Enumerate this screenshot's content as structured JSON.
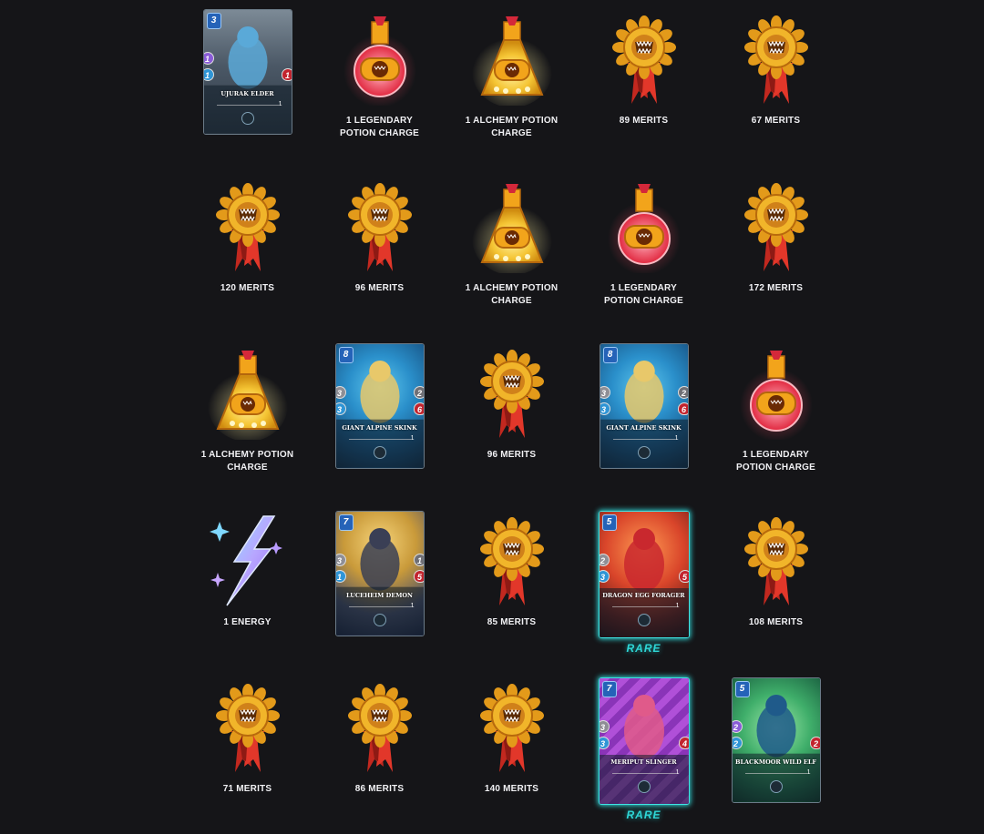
{
  "rewards": [
    {
      "kind": "card",
      "name": "UJURAK ELDER",
      "mana": "3",
      "attack": "1",
      "attack_type": "magic",
      "speed": "1",
      "health": "1",
      "level": "1",
      "theme": "ujurak"
    },
    {
      "kind": "legendary_potion",
      "label": "1 LEGENDARY POTION CHARGE"
    },
    {
      "kind": "alchemy_potion",
      "label": "1 ALCHEMY POTION CHARGE"
    },
    {
      "kind": "merits",
      "label": "89 MERITS"
    },
    {
      "kind": "merits",
      "label": "67 MERITS"
    },
    {
      "kind": "merits",
      "label": "120 MERITS"
    },
    {
      "kind": "merits",
      "label": "96 MERITS"
    },
    {
      "kind": "alchemy_potion",
      "label": "1 ALCHEMY POTION CHARGE"
    },
    {
      "kind": "legendary_potion",
      "label": "1 LEGENDARY POTION CHARGE"
    },
    {
      "kind": "merits",
      "label": "172 MERITS"
    },
    {
      "kind": "alchemy_potion",
      "label": "1 ALCHEMY POTION CHARGE"
    },
    {
      "kind": "card",
      "name": "GIANT ALPINE SKINK",
      "mana": "8",
      "attack": "3",
      "attack_type": "melee",
      "speed": "3",
      "armor": "2",
      "health": "6",
      "level": "1",
      "theme": "skink"
    },
    {
      "kind": "merits",
      "label": "96 MERITS"
    },
    {
      "kind": "card",
      "name": "GIANT ALPINE SKINK",
      "mana": "8",
      "attack": "3",
      "attack_type": "melee",
      "speed": "3",
      "armor": "2",
      "health": "6",
      "level": "1",
      "theme": "skink"
    },
    {
      "kind": "legendary_potion",
      "label": "1 LEGENDARY POTION CHARGE"
    },
    {
      "kind": "energy",
      "label": "1 ENERGY"
    },
    {
      "kind": "card",
      "name": "LUCEHEIM DEMON",
      "mana": "7",
      "attack": "3",
      "attack_type": "melee",
      "speed": "1",
      "armor": "1",
      "health": "5",
      "level": "1",
      "theme": "demon"
    },
    {
      "kind": "merits",
      "label": "85 MERITS"
    },
    {
      "kind": "card",
      "name": "DRAGON EGG FORAGER",
      "mana": "5",
      "attack": "2",
      "attack_type": "melee",
      "speed": "3",
      "health": "5",
      "level": "1",
      "theme": "dragon",
      "rarity": "RARE"
    },
    {
      "kind": "merits",
      "label": "108 MERITS"
    },
    {
      "kind": "merits",
      "label": "71 MERITS"
    },
    {
      "kind": "merits",
      "label": "86 MERITS"
    },
    {
      "kind": "merits",
      "label": "140 MERITS"
    },
    {
      "kind": "card",
      "name": "MERIPUT SLINGER",
      "mana": "7",
      "attack": "3",
      "attack_type": "melee",
      "speed": "3",
      "health": "4",
      "level": "1",
      "theme": "meriput",
      "rarity": "RARE"
    },
    {
      "kind": "card",
      "name": "BLACKMOOR WILD ELF",
      "mana": "5",
      "attack": "2",
      "attack_type": "magic",
      "speed": "2",
      "health": "2",
      "level": "1",
      "theme": "elf"
    }
  ]
}
